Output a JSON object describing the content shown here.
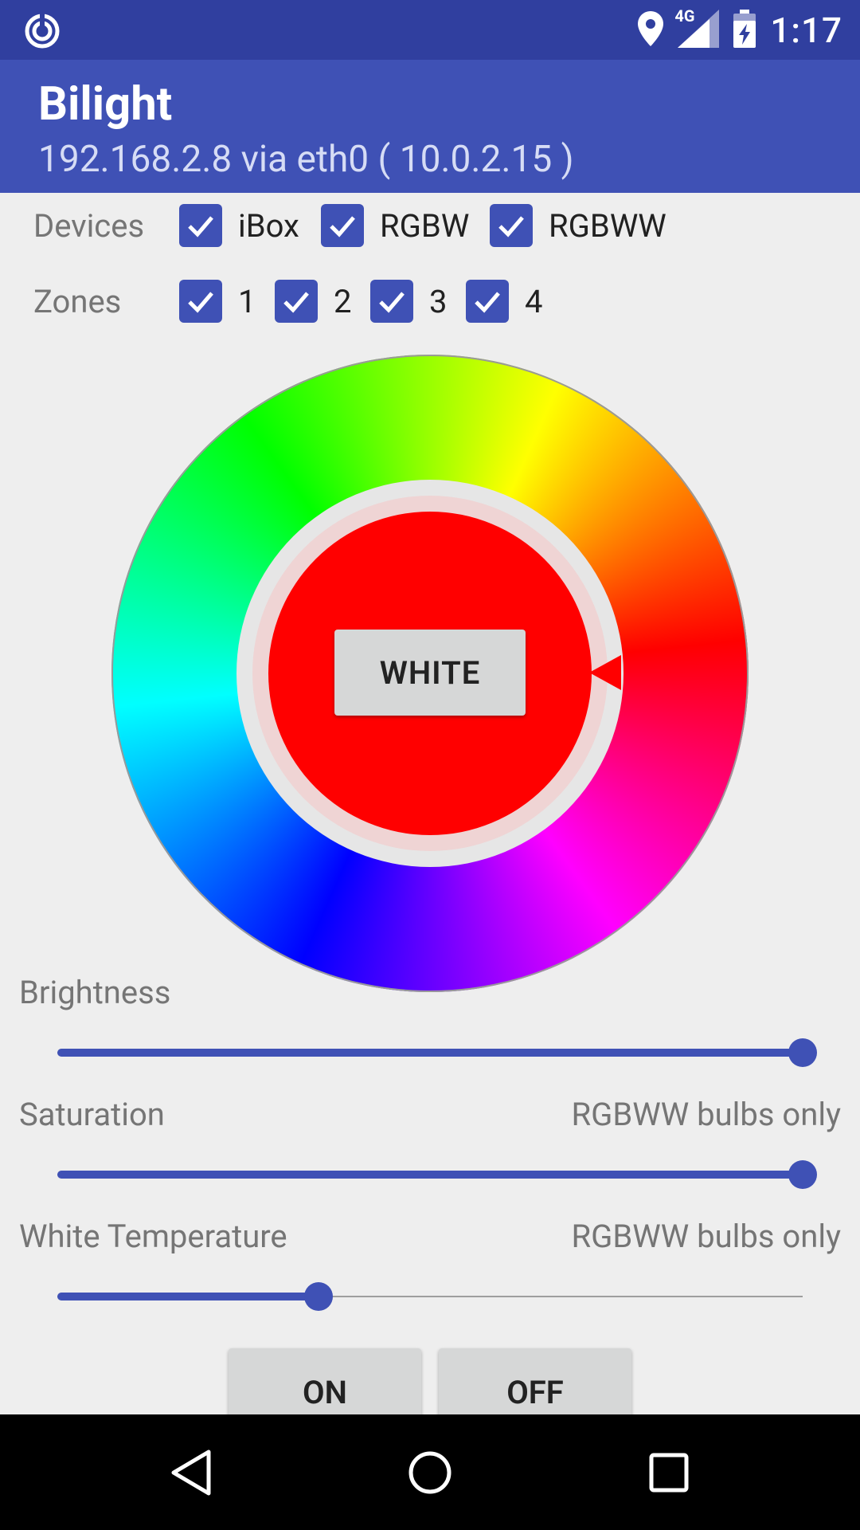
{
  "status_bar": {
    "time": "1:17",
    "network": "4G"
  },
  "app_bar": {
    "title": "Bilight",
    "subtitle": "192.168.2.8 via eth0 ( 10.0.2.15 )"
  },
  "devices": {
    "label": "Devices",
    "items": [
      {
        "label": "iBox",
        "checked": true
      },
      {
        "label": "RGBW",
        "checked": true
      },
      {
        "label": "RGBWW",
        "checked": true
      }
    ]
  },
  "zones": {
    "label": "Zones",
    "items": [
      {
        "label": "1",
        "checked": true
      },
      {
        "label": "2",
        "checked": true
      },
      {
        "label": "3",
        "checked": true
      },
      {
        "label": "4",
        "checked": true
      }
    ]
  },
  "color_wheel": {
    "selected_color": "#ff0000",
    "white_button_label": "WHITE"
  },
  "brightness": {
    "label": "Brightness",
    "value": 1.0
  },
  "saturation": {
    "label": "Saturation",
    "note": "RGBWW bulbs only",
    "value": 1.0
  },
  "white_temperature": {
    "label": "White Temperature",
    "note": "RGBWW bulbs only",
    "value": 0.35
  },
  "buttons": {
    "on_label": "ON",
    "off_label": "OFF"
  },
  "colors": {
    "primary": "#3F51B5",
    "primary_dark": "#303F9F",
    "background": "#eeeeee"
  }
}
